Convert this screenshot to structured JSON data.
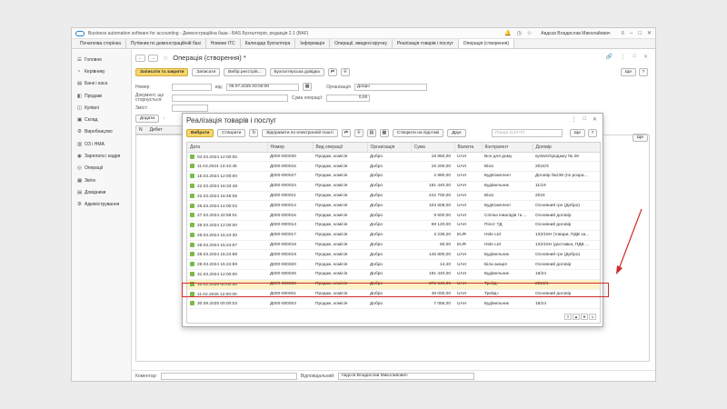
{
  "app": {
    "title": "Business automation software for accounting - Демонстраційна база - BAS Бухгалтерія, редакція 2.1 (BAF)",
    "user": "Авдєєв Владислав Миколайович"
  },
  "tabs": [
    "Початкова сторінка",
    "Путівник по демонстраційній базі",
    "Новини ІТС",
    "Календар бухгалтера",
    "Інформація",
    "Операції, введені вручну",
    "Реалізація товарів і послуг",
    "Операція (створення)"
  ],
  "sidebar": [
    {
      "icon": "☰",
      "label": "Головне"
    },
    {
      "icon": "◔",
      "label": "Керівнику"
    },
    {
      "icon": "▤",
      "label": "Банк і каса"
    },
    {
      "icon": "◧",
      "label": "Продажі"
    },
    {
      "icon": "◫",
      "label": "Купівлі"
    },
    {
      "icon": "▣",
      "label": "Склад"
    },
    {
      "icon": "⚙",
      "label": "Виробництво"
    },
    {
      "icon": "▥",
      "label": "ОЗ і НМА"
    },
    {
      "icon": "◉",
      "label": "Зарплата і кадри"
    },
    {
      "icon": "◎",
      "label": "Операції"
    },
    {
      "icon": "▦",
      "label": "Звіти"
    },
    {
      "icon": "▤",
      "label": "Довідники"
    },
    {
      "icon": "⚙",
      "label": "Адміністрування"
    }
  ],
  "document": {
    "title": "Операція (створення) *",
    "buttons": {
      "save_close": "Записати та закрити",
      "save": "Записати",
      "select_register": "Вибір реєстрів...",
      "accounting_ref": "Бухгалтерська довідка",
      "more": "Ще"
    },
    "fields": {
      "number_label": "Номер",
      "from_label": "від:",
      "date_value": "09.07.2025 00:00:00",
      "org_label": "Організація",
      "org_value": "Добро",
      "basis_label": "Документ, що сторнується:",
      "sum_label": "Сума операції:",
      "sum_value": "0,00",
      "content_label": "Зміст:"
    },
    "subtabs": {
      "add": "Додати"
    },
    "grid_headers": {
      "n": "N",
      "debit": "Дебет"
    },
    "bottom": {
      "comment_label": "Коментар:",
      "responsible_label": "Відповідальний:",
      "responsible_value": "Авдєєв Владислав Миколайович"
    }
  },
  "modal": {
    "title": "Реалізація товарів і послуг",
    "buttons": {
      "select": "Вибрати",
      "create": "Створити",
      "send_edoc": "Відправити по електронній пошті",
      "create_based": "Створити на підставі",
      "print": "Друк",
      "more": "Ще"
    },
    "search_placeholder": "Пошук (Ctrl+F)",
    "columns": [
      "Дата",
      "Номер",
      "Вид операції",
      "Організація",
      "Сума",
      "Валюта",
      "Контрагент",
      "Договір"
    ],
    "rows": [
      [
        "04.03.2024 12:00:00",
        "Д000-000030",
        "Продаж, комісія",
        "Добро",
        "18 850,00",
        "UAH",
        "Все для дому",
        "купівлі/продажу № 26"
      ],
      [
        "11.03.2024 13:42:45",
        "Д000-000015",
        "Продаж, комісія",
        "Добро",
        "16 200,00",
        "UAH",
        "Візіо",
        "2024/3"
      ],
      [
        "15.03.2024 12:00:00",
        "Д000-000027",
        "Продаж, комісія",
        "Добро",
        "2 880,00",
        "UAH",
        "БудКомплект",
        "Договір №236 (по розра..."
      ],
      [
        "22.03.2024 16:33:48",
        "Д000-000024",
        "Продаж, комісія",
        "Добро",
        "181 440,00",
        "UAH",
        "Будівельник",
        "11/19"
      ],
      [
        "22.03.2024 16:46:06",
        "Д000-000021",
        "Продаж, комісія",
        "Добро",
        "242 700,00",
        "UAH",
        "Візіо",
        "2024"
      ],
      [
        "26.03.2024 14:00:02",
        "Д000-000014",
        "Продаж, комісія",
        "Добро",
        "103 608,00",
        "UAH",
        "БудКомплект",
        "Основний грн (Добро)"
      ],
      [
        "27.03.2024 22:59:01",
        "Д000-000016",
        "Продаж, комісія",
        "Добро",
        "9 600,00",
        "UAH",
        "Спілка інвалідів та ...",
        "Основний договір"
      ],
      [
        "28.03.2024 12:00:00",
        "Д000-000013",
        "Продаж, комісія",
        "Добро",
        "69 120,00",
        "UAH",
        "Пілот ТД",
        "Основний договір"
      ],
      [
        "28.03.2024 15:24:30",
        "Д000-000017",
        "Продаж, комісія",
        "Добро",
        "3 236,20",
        "EUR",
        "Hide Ltd",
        "132/15Н (товари, ПДВ за..."
      ],
      [
        "28.03.2024 15:24:57",
        "Д000-000018",
        "Продаж, комісія",
        "Добро",
        "60,00",
        "EUR",
        "Hide Ltd",
        "132/15Н (доставка, ПДВ ..."
      ],
      [
        "28.03.2024 15:24:58",
        "Д000-000019",
        "Продаж, комісія",
        "Добро",
        "145 800,00",
        "UAH",
        "Будівельник",
        "Основний грн (Добро)"
      ],
      [
        "28.03.2024 15:24:59",
        "Д000-000020",
        "Продаж, комісія",
        "Добро",
        "14,40",
        "UAH",
        "Біла акація",
        "Основний договір"
      ],
      [
        "31.03.2024 12:00:00",
        "Д000-000026",
        "Продаж, комісія",
        "Добро",
        "181 440,00",
        "UAH",
        "Будівельник",
        "18/24"
      ],
      [
        "10.02.2025 00:00:00",
        "Д000-000002",
        "Продаж, комісія",
        "Добро",
        "872 640,00",
        "UAH",
        "Трейд+",
        "2024/1"
      ],
      [
        "11.02.2025 12:00:00",
        "Д000-000001",
        "Продаж, комісія",
        "Добро",
        "48 000,00",
        "UAH",
        "Трейд+",
        "Основний договір"
      ],
      [
        "30.09.2025 00:00:03",
        "Д000-000003",
        "Продаж, комісія",
        "Добро",
        "7 056,00",
        "UAH",
        "Будівельник",
        "18/24"
      ]
    ]
  },
  "colors": {
    "accent_yellow": "#f7d66b",
    "highlight_red": "#d02b2b",
    "row_icon": "#7bbb4a"
  }
}
